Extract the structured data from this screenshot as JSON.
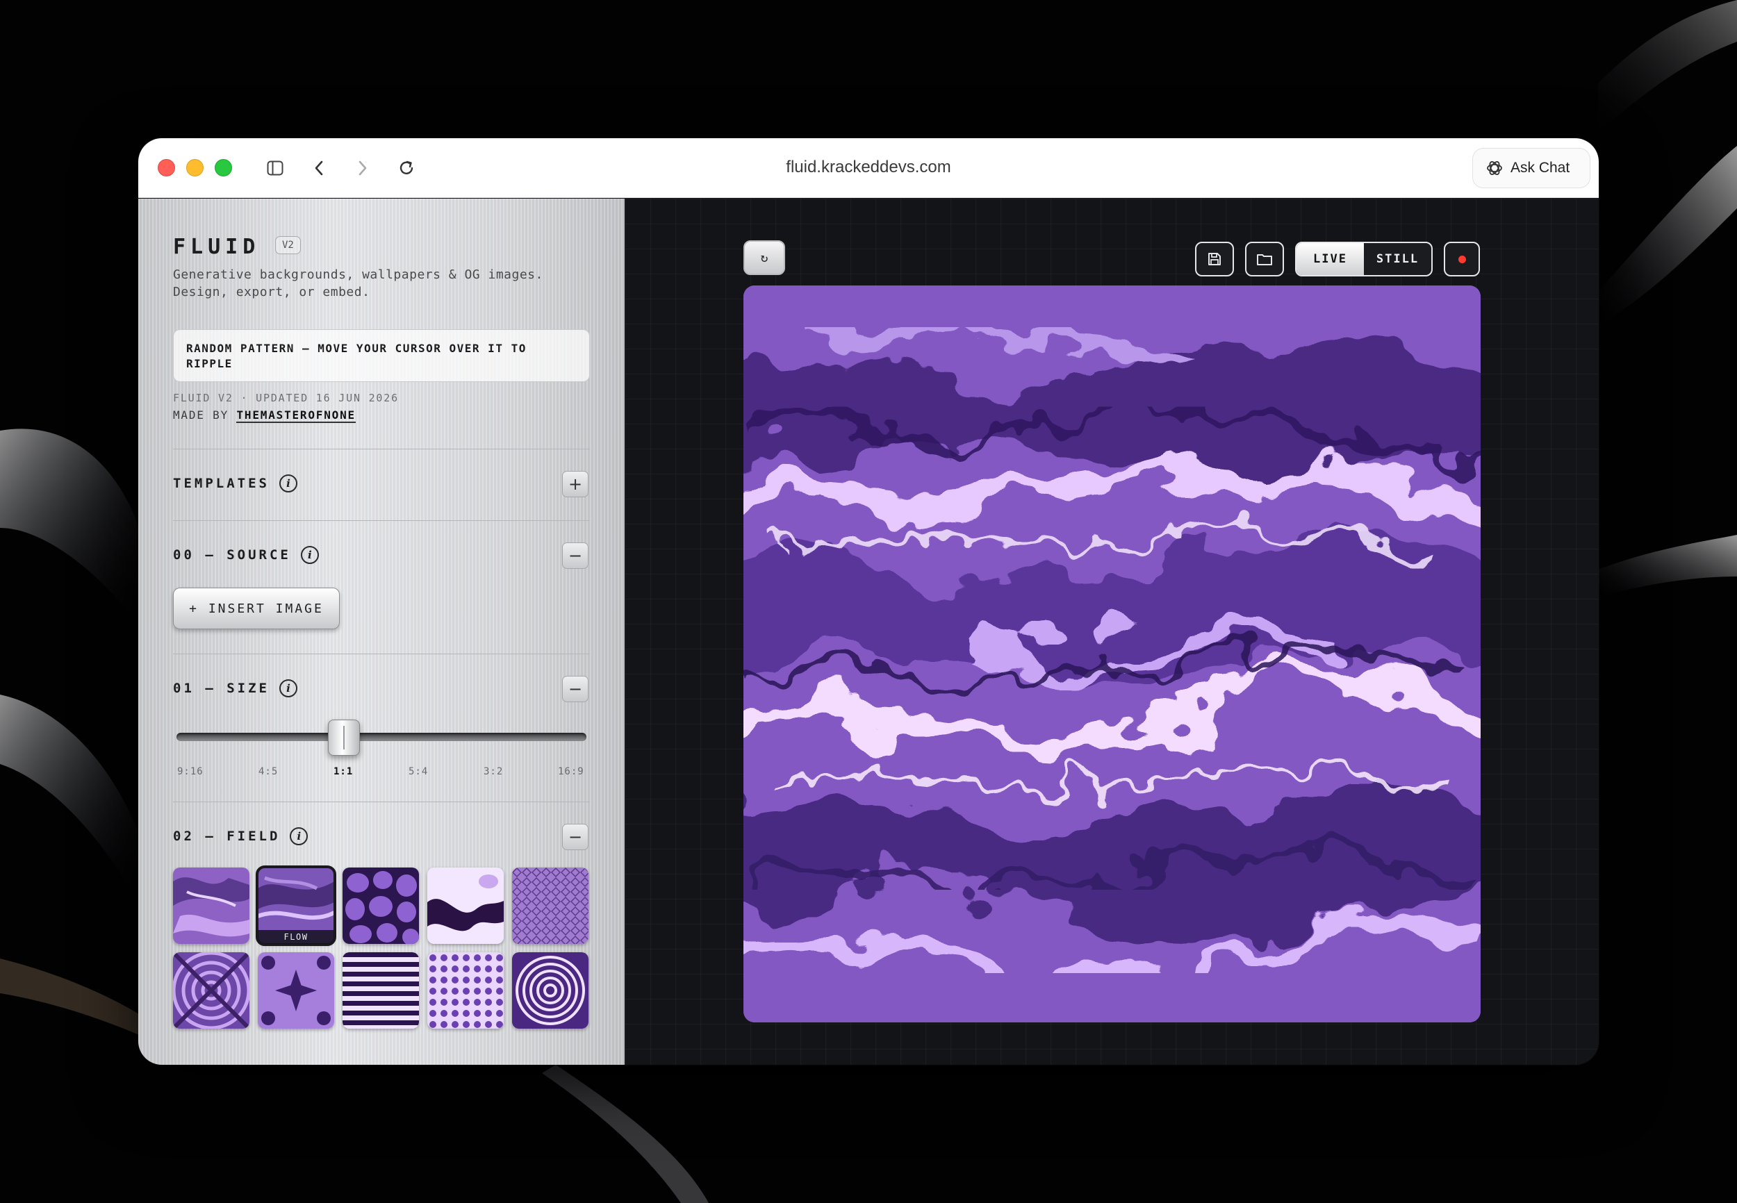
{
  "browser": {
    "url": "fluid.krackeddevs.com",
    "ask_chat_label": "Ask Chat"
  },
  "sidebar": {
    "brand": "FLUID",
    "version_badge": "V2",
    "tagline_line1": "Generative backgrounds, wallpapers & OG images.",
    "tagline_line2": "Design, export, or embed.",
    "notice": "RANDOM PATTERN — MOVE YOUR CURSOR OVER IT TO RIPPLE",
    "meta": "FLUID V2 · UPDATED 16 JUN 2026",
    "made_by_prefix": "MADE BY",
    "made_by_name": "THEMASTEROFNONE",
    "sections": {
      "templates": {
        "title": "TEMPLATES",
        "toggle": "+"
      },
      "source": {
        "title": "00 — SOURCE",
        "toggle": "−",
        "insert_label": "+ INSERT IMAGE"
      },
      "size": {
        "title": "01 — SIZE",
        "toggle": "−",
        "ticks": [
          "9:16",
          "4:5",
          "1:1",
          "5:4",
          "3:2",
          "16:9"
        ],
        "selected": "1:1"
      },
      "field": {
        "title": "02 — FIELD",
        "toggle": "−",
        "selected_caption": "FLOW",
        "thumbnails": [
          "marble",
          "flow",
          "cells",
          "blob",
          "diamonds",
          "swirl",
          "kaleido",
          "stripes",
          "dots",
          "rings"
        ]
      }
    }
  },
  "stage": {
    "reset_icon": "↻",
    "mode_live": "LIVE",
    "mode_still": "STILL",
    "active_mode": "LIVE"
  },
  "colors": {
    "accent_purple": "#7a53b3",
    "record_red": "#ff3b30"
  }
}
